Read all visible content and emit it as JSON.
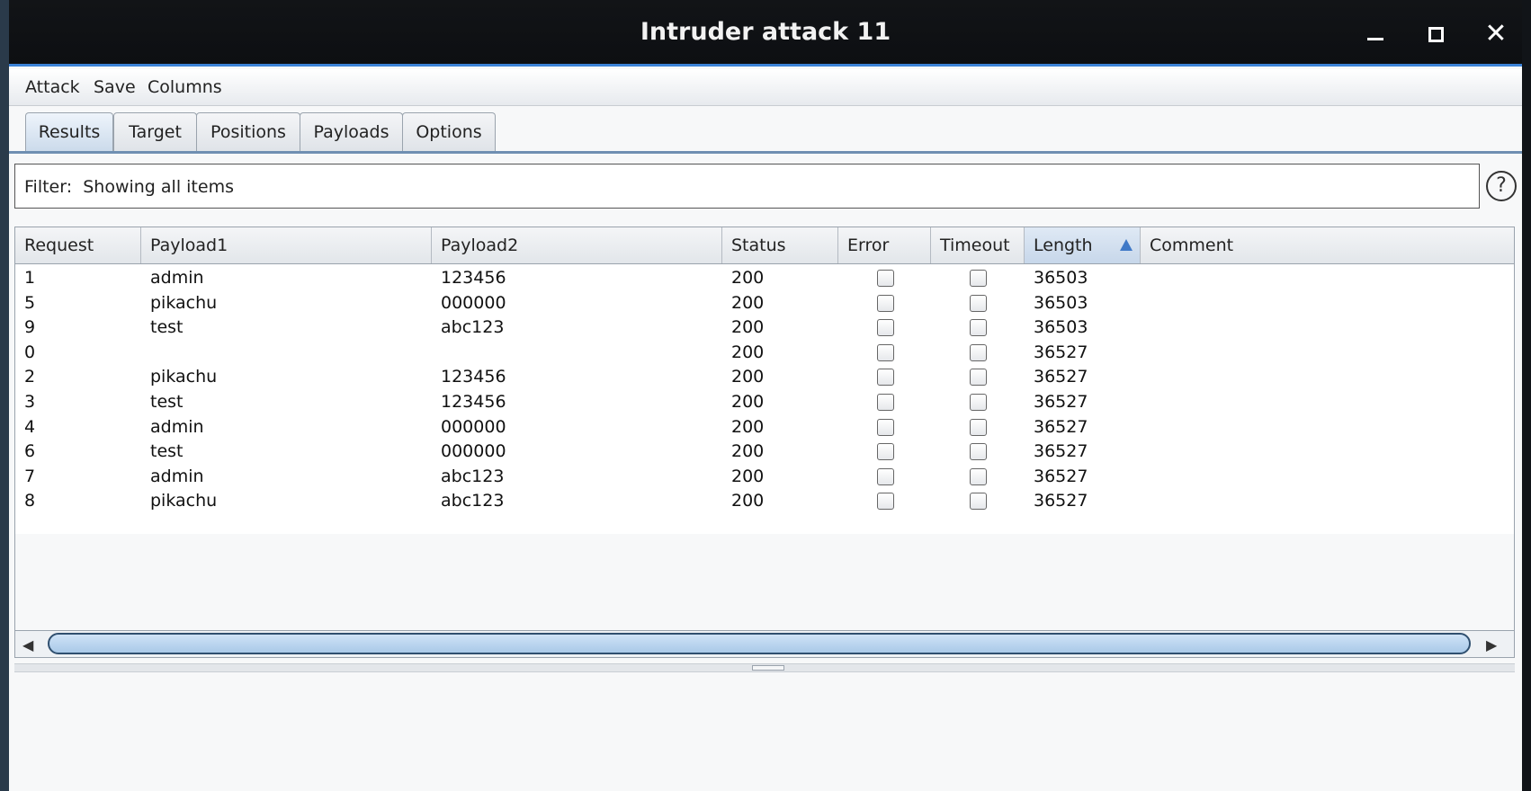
{
  "window": {
    "title": "Intruder attack 11"
  },
  "menu": [
    "Attack",
    "Save",
    "Columns"
  ],
  "tabs": [
    "Results",
    "Target",
    "Positions",
    "Payloads",
    "Options"
  ],
  "filter": {
    "label": "Filter:",
    "text": "Showing all items"
  },
  "help_label": "?",
  "table": {
    "columns": [
      "Request",
      "Payload1",
      "Payload2",
      "Status",
      "Error",
      "Timeout",
      "Length",
      "Comment"
    ],
    "sorted_column": "Length",
    "rows": [
      {
        "request": "1",
        "payload1": "admin",
        "payload2": "123456",
        "status": "200",
        "error": false,
        "timeout": false,
        "length": "36503",
        "comment": ""
      },
      {
        "request": "5",
        "payload1": "pikachu",
        "payload2": "000000",
        "status": "200",
        "error": false,
        "timeout": false,
        "length": "36503",
        "comment": ""
      },
      {
        "request": "9",
        "payload1": "test",
        "payload2": "abc123",
        "status": "200",
        "error": false,
        "timeout": false,
        "length": "36503",
        "comment": ""
      },
      {
        "request": "0",
        "payload1": "",
        "payload2": "",
        "status": "200",
        "error": false,
        "timeout": false,
        "length": "36527",
        "comment": ""
      },
      {
        "request": "2",
        "payload1": "pikachu",
        "payload2": "123456",
        "status": "200",
        "error": false,
        "timeout": false,
        "length": "36527",
        "comment": ""
      },
      {
        "request": "3",
        "payload1": "test",
        "payload2": "123456",
        "status": "200",
        "error": false,
        "timeout": false,
        "length": "36527",
        "comment": ""
      },
      {
        "request": "4",
        "payload1": "admin",
        "payload2": "000000",
        "status": "200",
        "error": false,
        "timeout": false,
        "length": "36527",
        "comment": ""
      },
      {
        "request": "6",
        "payload1": "test",
        "payload2": "000000",
        "status": "200",
        "error": false,
        "timeout": false,
        "length": "36527",
        "comment": ""
      },
      {
        "request": "7",
        "payload1": "admin",
        "payload2": "abc123",
        "status": "200",
        "error": false,
        "timeout": false,
        "length": "36527",
        "comment": ""
      },
      {
        "request": "8",
        "payload1": "pikachu",
        "payload2": "abc123",
        "status": "200",
        "error": false,
        "timeout": false,
        "length": "36527",
        "comment": ""
      }
    ]
  },
  "colors": {
    "title_accent": "#3b82d6",
    "sort_arrow": "#3f79c7"
  }
}
